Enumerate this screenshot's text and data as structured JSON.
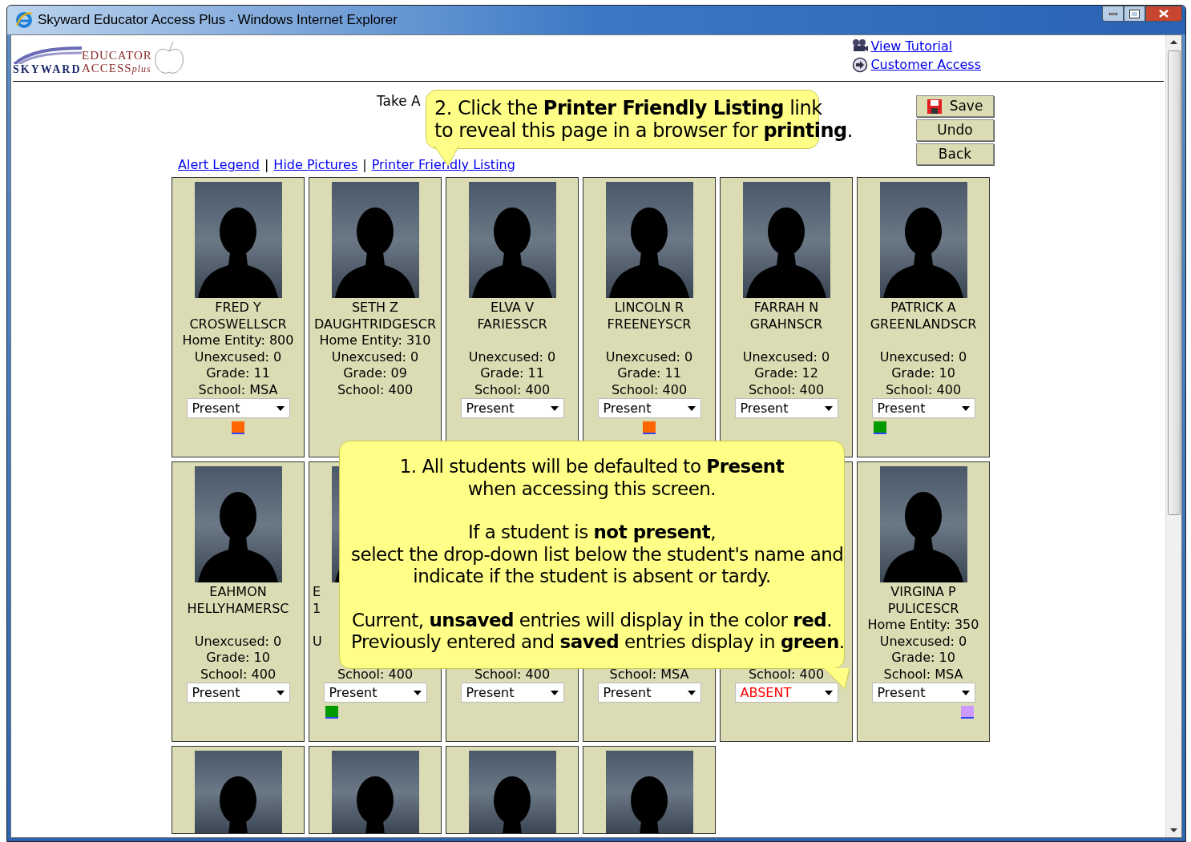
{
  "window": {
    "title": "Skyward Educator Access Plus - Windows Internet Explorer"
  },
  "logo": {
    "brand": "SKYWARD",
    "line1": "EDUCATOR",
    "line2": "ACCESS",
    "suffix": "plus"
  },
  "header_links": [
    {
      "kind": "tutorial",
      "label": "View Tutorial"
    },
    {
      "kind": "access",
      "label": "Customer Access"
    }
  ],
  "page_title": "Take A",
  "actions": [
    {
      "kind": "save",
      "label": "Save"
    },
    {
      "kind": "plain",
      "label": "Undo"
    },
    {
      "kind": "plain",
      "label": "Back"
    }
  ],
  "links": [
    {
      "kind": "link",
      "label": "Alert Legend"
    },
    {
      "kind": "separator",
      "label": "|"
    },
    {
      "kind": "link",
      "label": "Hide Pictures"
    },
    {
      "kind": "separator",
      "label": "|"
    },
    {
      "kind": "link",
      "label": "Printer Friendly Listing"
    }
  ],
  "students": [
    {
      "name": [
        "FRED Y",
        "CROSWELLSCR"
      ],
      "home_entity": "Home Entity: 800",
      "unexcused": "Unexcused: 0",
      "grade": "Grade: 11",
      "school": "School: MSA",
      "attendance": {
        "value": "Present",
        "unsaved": false
      },
      "marker": {
        "color": "#ff6600",
        "kind": "center"
      }
    },
    {
      "name": [
        "SETH Z",
        "DAUGHTRIDGESCR"
      ],
      "home_entity": "Home Entity: 310",
      "unexcused": "Unexcused: 0",
      "grade": "Grade: 09",
      "school": "School: 400"
    },
    {
      "name": [
        "ELVA V",
        "FARIESSCR"
      ],
      "unexcused": "Unexcused: 0",
      "grade": "Grade: 11",
      "school": "School: 400",
      "attendance": {
        "value": "Present",
        "unsaved": false
      }
    },
    {
      "name": [
        "LINCOLN R",
        "FREENEYSCR"
      ],
      "unexcused": "Unexcused: 0",
      "grade": "Grade: 11",
      "school": "School: 400",
      "attendance": {
        "value": "Present",
        "unsaved": false
      },
      "marker": {
        "color": "#ff6600",
        "kind": "center"
      }
    },
    {
      "name": [
        "FARRAH N",
        "GRAHNSCR"
      ],
      "unexcused": "Unexcused: 0",
      "grade": "Grade: 12",
      "school": "School: 400",
      "attendance": {
        "value": "Present",
        "unsaved": false
      }
    },
    {
      "name": [
        "PATRICK A",
        "GREENLANDSCR"
      ],
      "unexcused": "Unexcused: 0",
      "grade": "Grade: 10",
      "school": "School: 400",
      "attendance": {
        "value": "Present",
        "unsaved": false
      },
      "marker": {
        "color": "#009900",
        "kind": "left"
      }
    },
    {
      "name": [
        "EAHMON",
        "HELLYHAMERSC"
      ],
      "unexcused": "Unexcused: 0",
      "grade": "Grade: 10",
      "school": "School: 400",
      "attendance": {
        "value": "Present",
        "unsaved": false
      }
    },
    {
      "covered": true,
      "name": [
        "E",
        "1"
      ],
      "unexcused": "U",
      "school": "School: 400",
      "attendance": {
        "value": "Present",
        "unsaved": false
      },
      "marker": {
        "color": "#009900",
        "kind": "left"
      }
    },
    {
      "school": "School: 400",
      "attendance": {
        "value": "Present",
        "unsaved": false
      }
    },
    {
      "school": "School: MSA",
      "attendance": {
        "value": "Present",
        "unsaved": false
      }
    },
    {
      "school": "School: 400",
      "attendance": {
        "value": "ABSENT",
        "unsaved": true
      }
    },
    {
      "name": [
        "VIRGINA P",
        "PULICESCR"
      ],
      "home_entity": "Home Entity: 350",
      "unexcused": "Unexcused: 0",
      "grade": "Grade: 10",
      "school": "School: MSA",
      "attendance": {
        "value": "Present",
        "unsaved": false
      },
      "marker": {
        "color": "#cc99ff",
        "kind": "right"
      }
    },
    {
      "cut": true
    },
    {
      "cut": true
    },
    {
      "cut": true
    },
    {
      "cut": true
    }
  ],
  "callouts": [
    {
      "kind": "top",
      "paragraphs": [
        [
          "2.  Click the **Printer Friendly Listing** link",
          "to reveal this page in a browser for **printing**."
        ]
      ]
    },
    {
      "kind": "bottom",
      "paragraphs": [
        [
          "1.  All students will be defaulted to **Present**",
          "when accessing this screen."
        ],
        [
          "If a student is **not present**,",
          "select the drop-down list below the student's name and",
          "indicate if the student is absent or tardy."
        ],
        [
          "Current, **unsaved** entries will display in the color **red**.",
          "Previously entered and **saved** entries display in **green**."
        ]
      ]
    }
  ]
}
